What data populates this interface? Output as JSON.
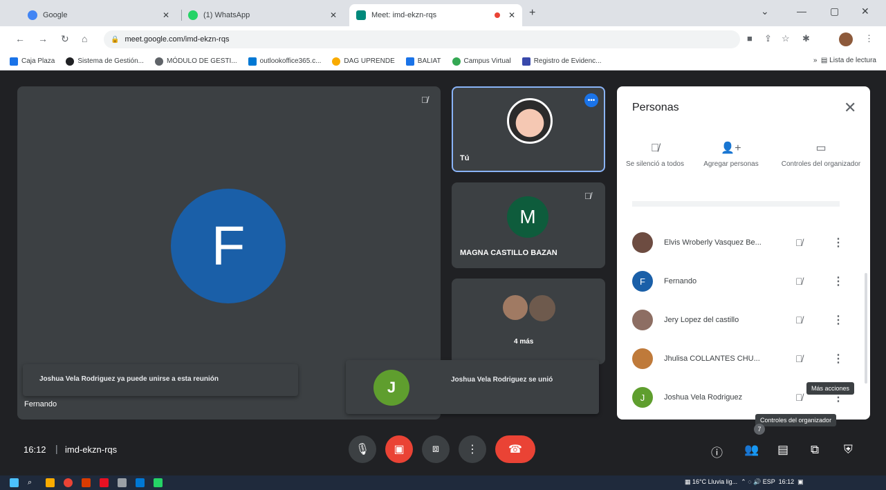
{
  "browser": {
    "tabs": [
      {
        "title": "Google",
        "active": false,
        "color": "#4285f4"
      },
      {
        "title": "(1) WhatsApp",
        "active": false,
        "color": "#25d366"
      },
      {
        "title": "Meet: imd-ekzn-rqs",
        "active": true,
        "color": "#00897b"
      }
    ],
    "new_tab_label": "+",
    "url": "meet.google.com/imd-ekzn-rqs",
    "bookmarks": [
      {
        "label": "Caja Plaza",
        "color": "#1a73e8"
      },
      {
        "label": "Sistema de Gestión...",
        "color": "#202124"
      },
      {
        "label": "MÓDULO DE GESTI...",
        "color": "#5f6368"
      },
      {
        "label": "outlookoffice365.c...",
        "color": "#0078d4"
      },
      {
        "label": "DAG UPRENDE",
        "color": "#f9ab00"
      },
      {
        "label": "BALIAT",
        "color": "#1a73e8"
      },
      {
        "label": "Campus Virtual",
        "color": "#34a853"
      },
      {
        "label": "Registro de Evidenc...",
        "color": "#3949ab"
      }
    ],
    "reading_list": "Lista de lectura"
  },
  "meet": {
    "main_tile": {
      "initial": "F",
      "name": "Fernando"
    },
    "tiles": {
      "self": {
        "label": "Tú",
        "more": "•••"
      },
      "magna": {
        "initial": "M",
        "name": "MAGNA CASTILLO BAZAN"
      },
      "more": {
        "label": "4 más"
      }
    },
    "toast_join": "Joshua Vela Rodriguez ya puede unirse a esta reunión",
    "toast_joined": {
      "initial": "J",
      "text": "Joshua Vela Rodriguez se unió"
    },
    "panel": {
      "title": "Personas",
      "close": "✕",
      "actions": [
        {
          "icon": "🎙",
          "label": "Se silenció a todos"
        },
        {
          "icon": "👤",
          "label": "Agregar personas"
        },
        {
          "icon": "▭",
          "label": "Controles del organizador"
        }
      ],
      "people": [
        {
          "initial": "",
          "name": "Elvis Wroberly Vasquez Be...",
          "color": "#6d4c41"
        },
        {
          "initial": "F",
          "name": "Fernando",
          "color": "#1a5fa8"
        },
        {
          "initial": "",
          "name": "Jery Lopez del castillo",
          "color": "#8d6e63"
        },
        {
          "initial": "",
          "name": "Jhulisa COLLANTES CHU...",
          "color": "#bf7a3a"
        },
        {
          "initial": "J",
          "name": "Joshua Vela Rodriguez",
          "color": "#5f9e2e"
        }
      ],
      "tooltip_more": "Más acciones",
      "tooltip_host": "Controles del organizador"
    },
    "bottom": {
      "time": "16:12",
      "code": "imd-ekzn-rqs",
      "people_count": "7"
    }
  },
  "taskbar": {
    "weather": "16°C Lluvia lig...",
    "lang": "ESP",
    "clock": "16:12"
  }
}
